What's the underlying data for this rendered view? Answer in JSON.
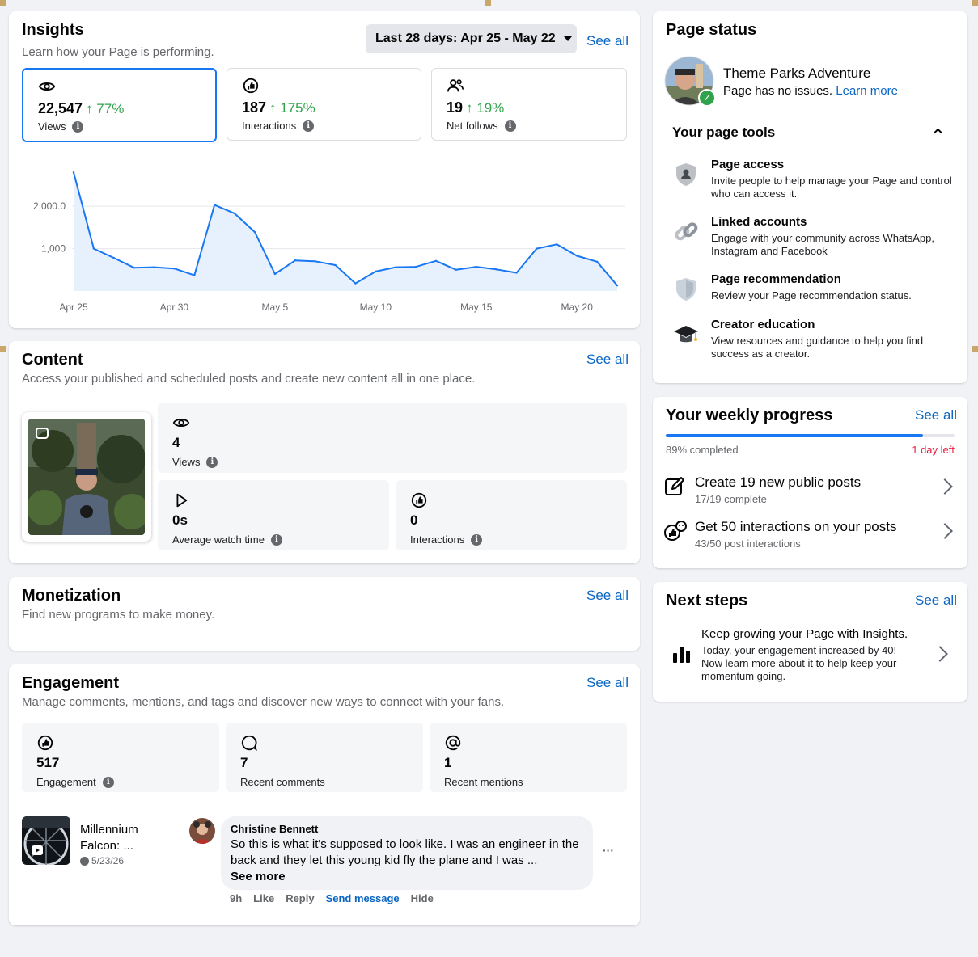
{
  "insights": {
    "title": "Insights",
    "subtitle": "Learn how your Page is performing.",
    "date_range": "Last 28 days: Apr 25 - May 22",
    "see_all": "See all",
    "stats": [
      {
        "value": "22,547",
        "change": "↑ 77%",
        "label": "Views"
      },
      {
        "value": "187",
        "change": "↑ 175%",
        "label": "Interactions"
      },
      {
        "value": "19",
        "change": "↑ 19%",
        "label": "Net follows"
      }
    ]
  },
  "chart_data": {
    "type": "area",
    "x": [
      "Apr 25",
      "Apr 26",
      "Apr 27",
      "Apr 28",
      "Apr 29",
      "Apr 30",
      "May 1",
      "May 2",
      "May 3",
      "May 4",
      "May 5",
      "May 6",
      "May 7",
      "May 8",
      "May 9",
      "May 10",
      "May 11",
      "May 12",
      "May 13",
      "May 14",
      "May 15",
      "May 16",
      "May 17",
      "May 18",
      "May 19",
      "May 20",
      "May 21",
      "May 22"
    ],
    "values": [
      2800,
      1000,
      780,
      550,
      560,
      530,
      370,
      2030,
      1830,
      1390,
      400,
      720,
      700,
      610,
      180,
      460,
      560,
      570,
      710,
      500,
      570,
      510,
      430,
      1000,
      1100,
      830,
      690,
      130
    ],
    "tick_labels_x": [
      "Apr 25",
      "Apr 30",
      "May 5",
      "May 10",
      "May 15",
      "May 20"
    ],
    "tick_labels_y": [
      "1,000",
      "2,000.0"
    ],
    "ylim": [
      0,
      2900
    ],
    "color": "#1877f2",
    "fill": "#e7f0fd",
    "grid": true
  },
  "content": {
    "title": "Content",
    "subtitle": "Access your published and scheduled posts and create new content all in one place.",
    "see_all": "See all",
    "views_value": "4",
    "views_label": "Views",
    "watch_value": "0s",
    "watch_label": "Average watch time",
    "interactions_value": "0",
    "interactions_label": "Interactions"
  },
  "monetization": {
    "title": "Monetization",
    "subtitle": "Find new programs to make money.",
    "see_all": "See all"
  },
  "engagement": {
    "title": "Engagement",
    "subtitle": "Manage comments, mentions, and tags and discover new ways to connect with your fans.",
    "see_all": "See all",
    "stats": [
      {
        "value": "517",
        "label": "Engagement"
      },
      {
        "value": "7",
        "label": "Recent comments"
      },
      {
        "value": "1",
        "label": "Recent mentions"
      }
    ],
    "post_title_line1": "Millennium",
    "post_title_line2": "Falcon: ...",
    "post_date": "5/23/26",
    "comment_author": "Christine Bennett",
    "comment_text": "So this is what it's supposed to look like. I was an engineer in the back and they let this young kid fly the plane and I was ...",
    "see_more": "See more",
    "actions": {
      "time": "9h",
      "like": "Like",
      "reply": "Reply",
      "send": "Send message",
      "hide": "Hide"
    },
    "more": "···"
  },
  "page_status": {
    "title": "Page status",
    "page_name": "Theme Parks Adventure",
    "status": "Page has no issues.",
    "learn_more": "Learn more",
    "tools_title": "Your page tools",
    "tools": [
      {
        "name": "Page access",
        "desc": "Invite people to help manage your Page and control who can access it."
      },
      {
        "name": "Linked accounts",
        "desc": "Engage with your community across WhatsApp, Instagram and Facebook"
      },
      {
        "name": "Page recommendation",
        "desc": "Review your Page recommendation status."
      },
      {
        "name": "Creator education",
        "desc": "View resources and guidance to help you find success as a creator."
      }
    ]
  },
  "weekly": {
    "title": "Your weekly progress",
    "see_all": "See all",
    "progress": 0.89,
    "completed": "89% completed",
    "time_left": "1 day left",
    "items": [
      {
        "name": "Create 19 new public posts",
        "sub": "17/19 complete"
      },
      {
        "name": "Get 50 interactions on your posts",
        "sub": "43/50 post interactions"
      }
    ]
  },
  "next_steps": {
    "title": "Next steps",
    "see_all": "See all",
    "heading": "Keep growing your Page with Insights.",
    "body": "Today, your engagement increased by 40! Now learn more about it to help keep your momentum going."
  }
}
